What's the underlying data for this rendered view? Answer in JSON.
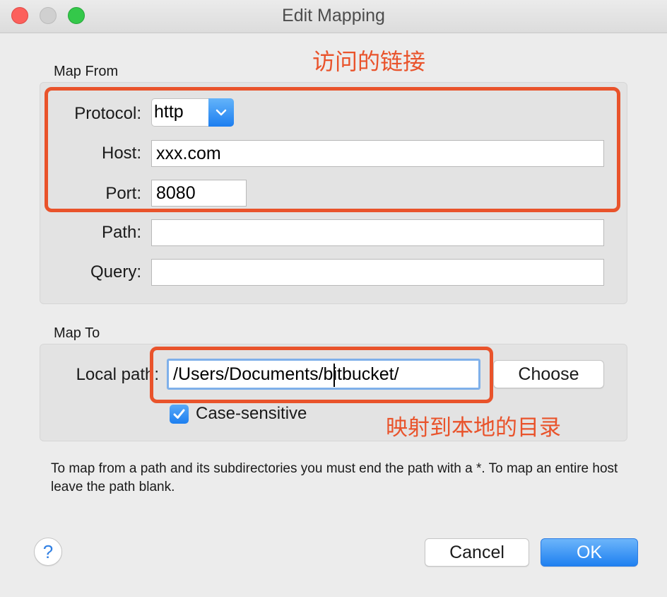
{
  "window": {
    "title": "Edit Mapping"
  },
  "map_from": {
    "section_label": "Map From",
    "protocol_label": "Protocol:",
    "protocol_value": "http",
    "host_label": "Host:",
    "host_value": "xxx.com",
    "port_label": "Port:",
    "port_value": "8080",
    "path_label": "Path:",
    "path_value": "",
    "query_label": "Query:",
    "query_value": ""
  },
  "map_to": {
    "section_label": "Map To",
    "local_path_label": "Local path:",
    "local_path_value": "/Users/Documents/bitbucket/",
    "choose_button": "Choose",
    "case_sensitive_label": "Case-sensitive",
    "case_sensitive_checked": true
  },
  "help_text": "To map from a path and its subdirectories you must end the path with a *. To map an entire host leave the path blank.",
  "footer": {
    "help_label": "?",
    "cancel": "Cancel",
    "ok": "OK"
  },
  "annotations": {
    "map_from_note": "访问的链接",
    "map_to_note": "映射到本地的目录",
    "color": "#e9532b"
  },
  "colors": {
    "accent": "#1f80f0"
  }
}
